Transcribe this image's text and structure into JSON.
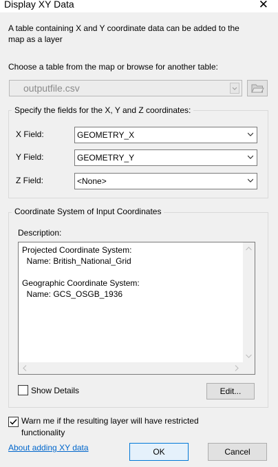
{
  "window": {
    "title": "Display XY Data"
  },
  "intro": {
    "line1": "A table containing X and Y coordinate data can be added to the",
    "line2": "map as a layer"
  },
  "table_chooser": {
    "label": "Choose a table from the map or browse for another table:",
    "value": "outputfile.csv"
  },
  "fields_group": {
    "label": "Specify the fields for the X, Y and Z coordinates:",
    "x_label": "X Field:",
    "x_value": "GEOMETRY_X",
    "y_label": "Y Field:",
    "y_value": "GEOMETRY_Y",
    "z_label": "Z Field:",
    "z_value": "<None>"
  },
  "coord_group": {
    "label": "Coordinate System of Input Coordinates",
    "description_label": "Description:",
    "description_lines": [
      "Projected Coordinate System:",
      "  Name: British_National_Grid",
      "",
      "Geographic Coordinate System:",
      "  Name: GCS_OSGB_1936"
    ],
    "show_details_label": "Show Details",
    "show_details_checked": false,
    "edit_label": "Edit..."
  },
  "warn": {
    "line1": "Warn me if the resulting layer will have restricted",
    "line2": "functionality",
    "checked": true
  },
  "footer": {
    "help_link": "About adding XY data",
    "ok_label": "OK",
    "cancel_label": "Cancel"
  }
}
